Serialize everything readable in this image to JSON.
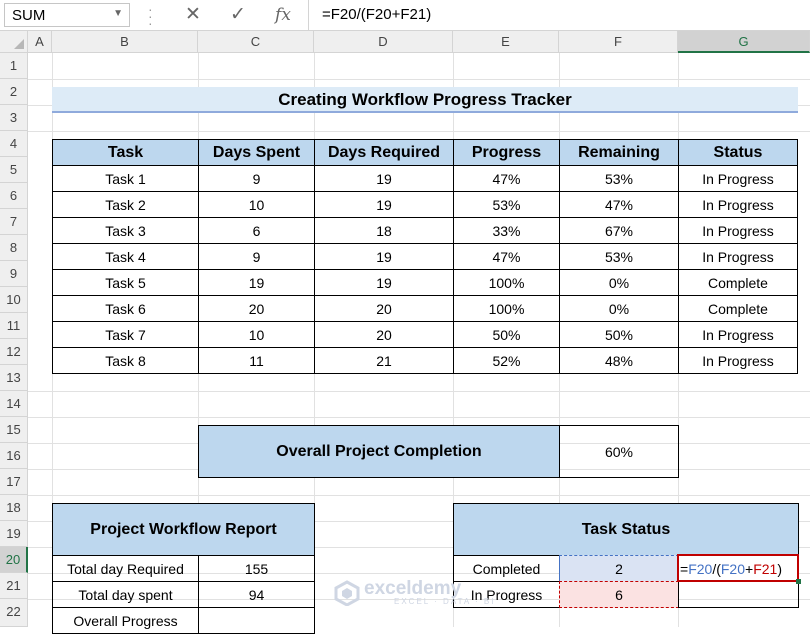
{
  "formula_bar": {
    "name_box": "SUM",
    "cancel_icon": "✕",
    "enter_icon": "✓",
    "fx_label": "fx",
    "formula": "=F20/(F20+F21)"
  },
  "columns": [
    "A",
    "B",
    "C",
    "D",
    "E",
    "F",
    "G"
  ],
  "rows": [
    "1",
    "2",
    "3",
    "4",
    "5",
    "6",
    "7",
    "8",
    "9",
    "10",
    "11",
    "12",
    "13",
    "14",
    "15",
    "16",
    "17",
    "18",
    "19",
    "20",
    "21",
    "22"
  ],
  "title": "Creating Workflow Progress Tracker",
  "tracker": {
    "headers": [
      "Task",
      "Days Spent",
      "Days Required",
      "Progress",
      "Remaining",
      "Status"
    ],
    "rows": [
      [
        "Task 1",
        "9",
        "19",
        "47%",
        "53%",
        "In Progress"
      ],
      [
        "Task 2",
        "10",
        "19",
        "53%",
        "47%",
        "In Progress"
      ],
      [
        "Task 3",
        "6",
        "18",
        "33%",
        "67%",
        "In Progress"
      ],
      [
        "Task 4",
        "9",
        "19",
        "47%",
        "53%",
        "In Progress"
      ],
      [
        "Task 5",
        "19",
        "19",
        "100%",
        "0%",
        "Complete"
      ],
      [
        "Task 6",
        "20",
        "20",
        "100%",
        "0%",
        "Complete"
      ],
      [
        "Task 7",
        "10",
        "20",
        "50%",
        "50%",
        "In Progress"
      ],
      [
        "Task 8",
        "11",
        "21",
        "52%",
        "48%",
        "In Progress"
      ]
    ]
  },
  "overall": {
    "label": "Overall Project Completion",
    "value": "60%"
  },
  "report": {
    "title": "Project Workflow Report",
    "rows": [
      [
        "Total day Required",
        "155"
      ],
      [
        "Total day spent",
        "94"
      ],
      [
        "Overall Progress",
        ""
      ]
    ]
  },
  "task_status": {
    "title": "Task Status",
    "rows": [
      [
        "Completed",
        "2"
      ],
      [
        "In Progress",
        "6"
      ]
    ],
    "editing_formula": {
      "eq": "=",
      "ref1": "F20",
      "op": "/(",
      "ref2": "F20",
      "plus": "+",
      "ref3": "F21",
      "close": ")"
    }
  },
  "watermark": {
    "name": "exceldemy",
    "tag": "EXCEL · DATA · BI"
  },
  "colors": {
    "header_fill": "#bdd7ee",
    "title_fill": "#ddebf7",
    "ref_blue": "#4472c4",
    "ref_red": "#c00000",
    "select_green": "#217346"
  }
}
